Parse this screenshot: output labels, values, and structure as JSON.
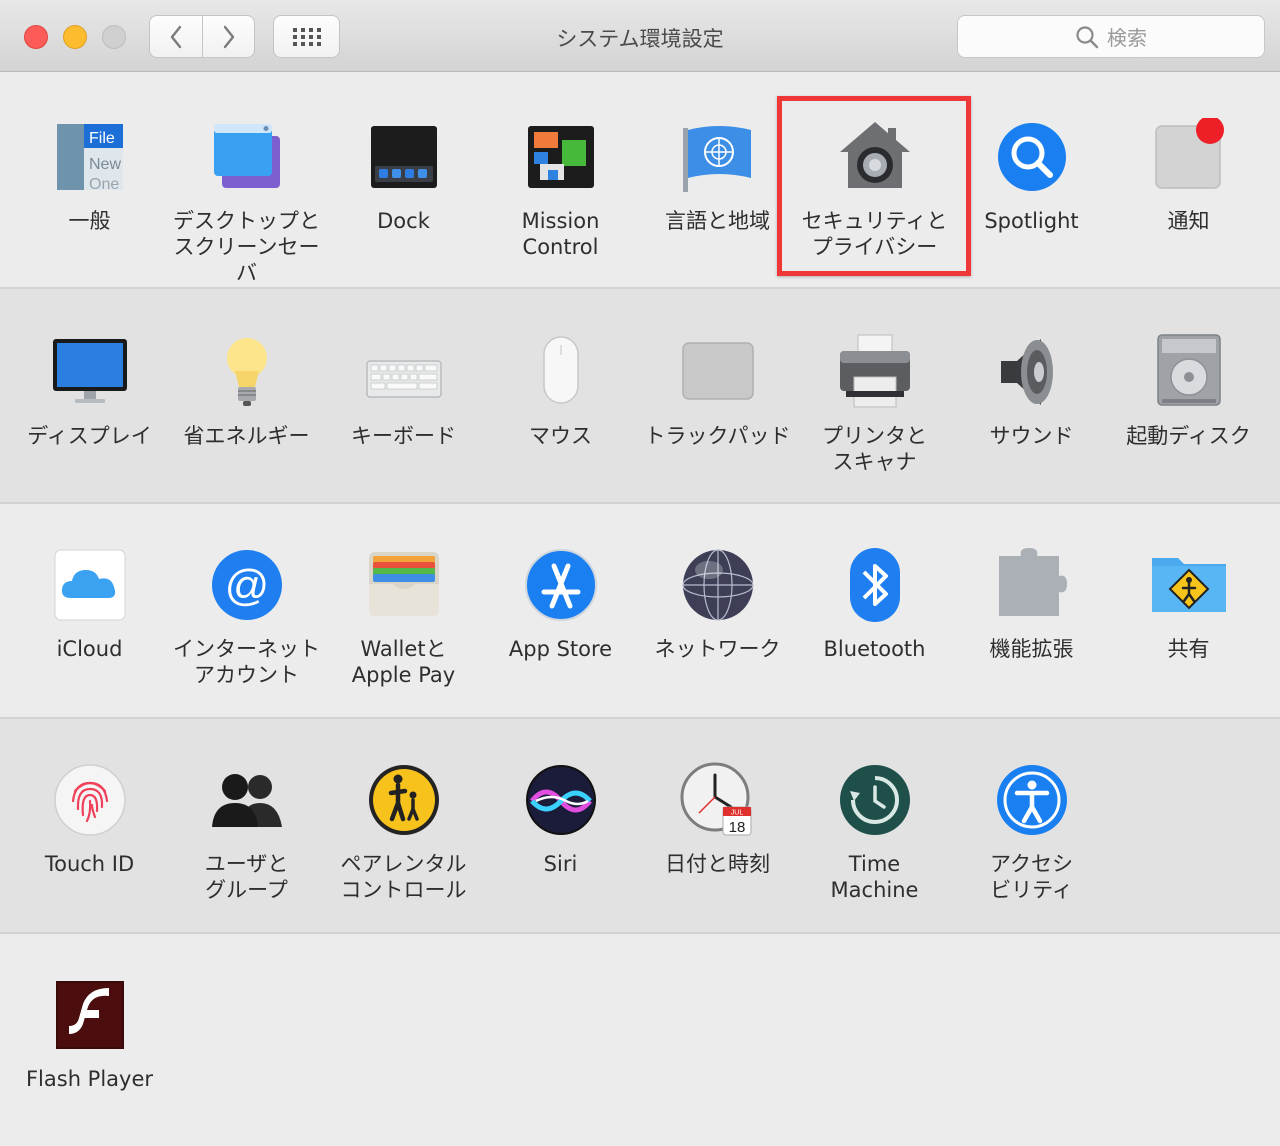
{
  "window": {
    "title": "システム環境設定"
  },
  "search": {
    "placeholder": "検索"
  },
  "rows": [
    [
      {
        "label": "一般",
        "icon": "general-icon"
      },
      {
        "label": "デスクトップと\nスクリーンセーバ",
        "icon": "desktop-screensaver-icon"
      },
      {
        "label": "Dock",
        "icon": "dock-icon"
      },
      {
        "label": "Mission\nControl",
        "icon": "mission-control-icon"
      },
      {
        "label": "言語と地域",
        "icon": "language-region-icon"
      },
      {
        "label": "セキュリティと\nプライバシー",
        "icon": "security-privacy-icon"
      },
      {
        "label": "Spotlight",
        "icon": "spotlight-icon"
      },
      {
        "label": "通知",
        "icon": "notifications-icon"
      }
    ],
    [
      {
        "label": "ディスプレイ",
        "icon": "display-icon"
      },
      {
        "label": "省エネルギー",
        "icon": "energy-saver-icon"
      },
      {
        "label": "キーボード",
        "icon": "keyboard-icon"
      },
      {
        "label": "マウス",
        "icon": "mouse-icon"
      },
      {
        "label": "トラックパッド",
        "icon": "trackpad-icon"
      },
      {
        "label": "プリンタと\nスキャナ",
        "icon": "printer-scanner-icon"
      },
      {
        "label": "サウンド",
        "icon": "sound-icon"
      },
      {
        "label": "起動ディスク",
        "icon": "startup-disk-icon"
      }
    ],
    [
      {
        "label": "iCloud",
        "icon": "icloud-icon"
      },
      {
        "label": "インターネット\nアカウント",
        "icon": "internet-accounts-icon"
      },
      {
        "label": "Walletと\nApple Pay",
        "icon": "wallet-applepay-icon"
      },
      {
        "label": "App Store",
        "icon": "app-store-icon"
      },
      {
        "label": "ネットワーク",
        "icon": "network-icon"
      },
      {
        "label": "Bluetooth",
        "icon": "bluetooth-icon"
      },
      {
        "label": "機能拡張",
        "icon": "extensions-icon"
      },
      {
        "label": "共有",
        "icon": "sharing-icon"
      }
    ],
    [
      {
        "label": "Touch ID",
        "icon": "touch-id-icon"
      },
      {
        "label": "ユーザと\nグループ",
        "icon": "users-groups-icon"
      },
      {
        "label": "ペアレンタル\nコントロール",
        "icon": "parental-controls-icon"
      },
      {
        "label": "Siri",
        "icon": "siri-icon"
      },
      {
        "label": "日付と時刻",
        "icon": "date-time-icon"
      },
      {
        "label": "Time\nMachine",
        "icon": "time-machine-icon"
      },
      {
        "label": "アクセシ\nビリティ",
        "icon": "accessibility-icon"
      }
    ],
    [
      {
        "label": "Flash Player",
        "icon": "flash-player-icon"
      }
    ]
  ],
  "icon_text": {
    "general_file": "File",
    "general_new": "New",
    "general_one": "One",
    "calendar_month": "JUL",
    "calendar_day": "18"
  },
  "highlight": {
    "target": "セキュリティと\nプライバシー",
    "color": "#ef3737"
  }
}
